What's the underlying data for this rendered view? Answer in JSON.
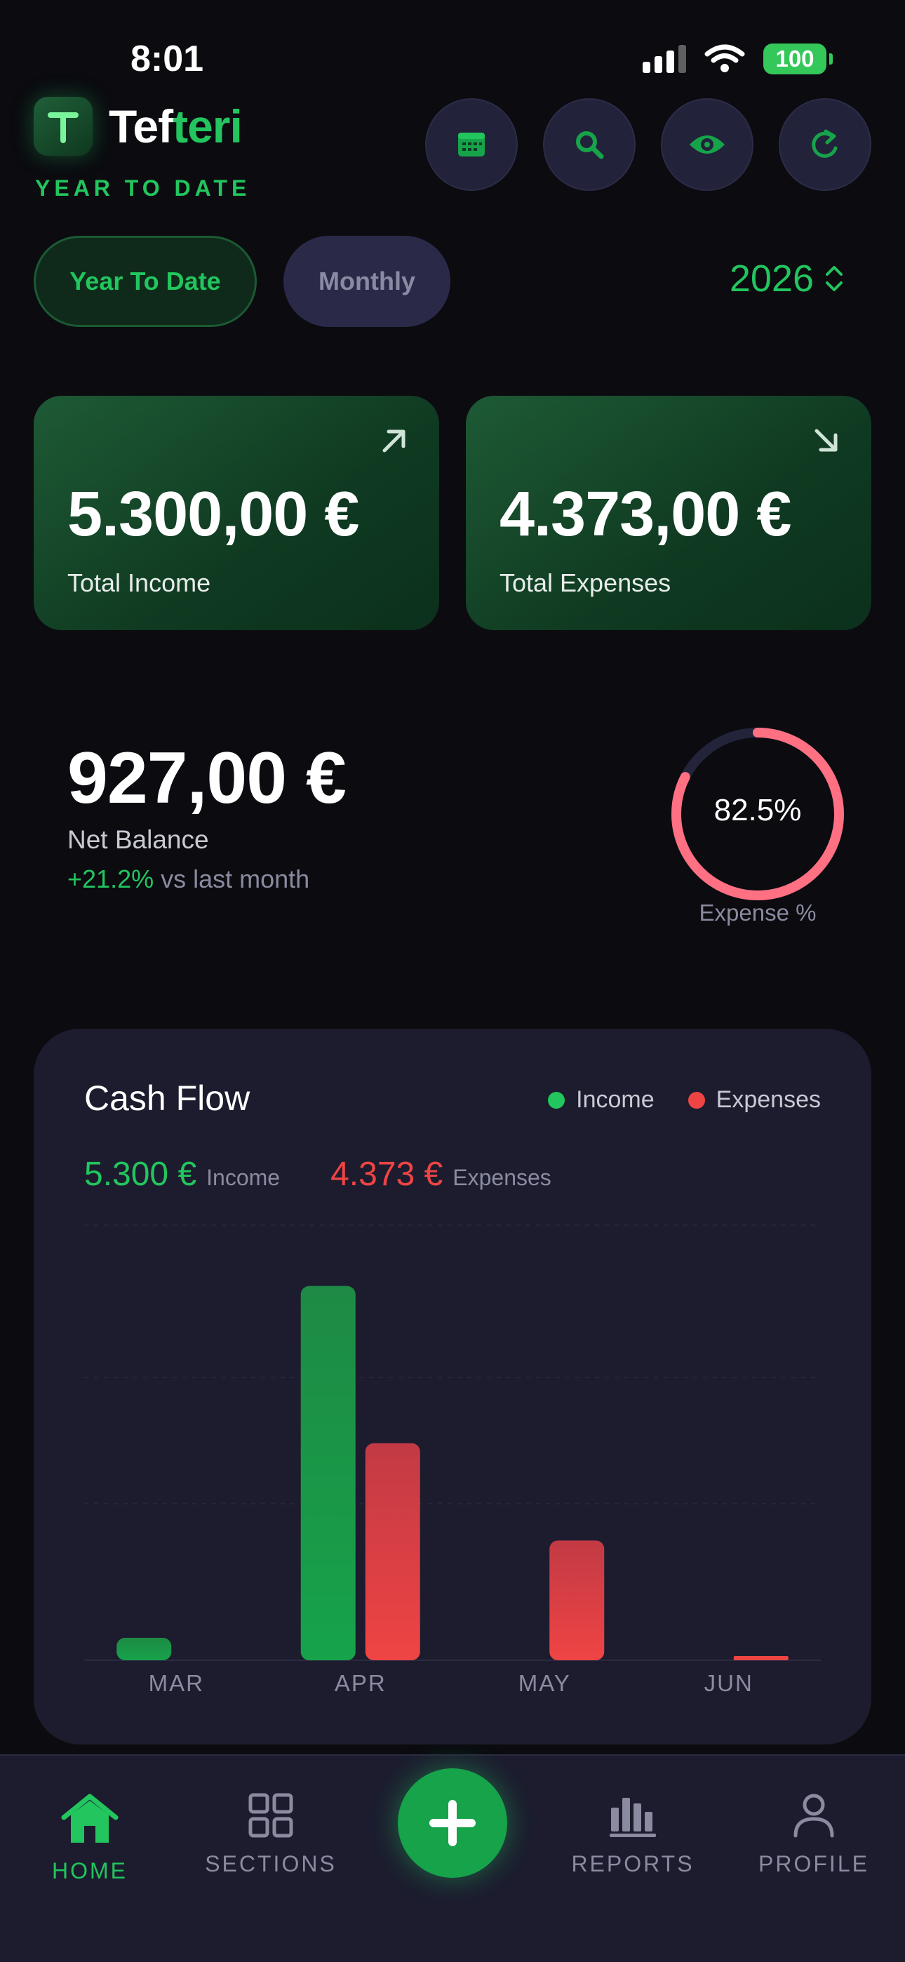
{
  "status_bar": {
    "time": "8:01",
    "battery": "100"
  },
  "header": {
    "logo_letter": "T",
    "app_name_part1": "Tef",
    "app_name_part2": "teri",
    "subtitle": "YEAR TO DATE",
    "buttons": [
      "calendar-icon",
      "search-icon",
      "eye-icon",
      "refresh-icon"
    ]
  },
  "tabs": {
    "active": "Year To Date",
    "inactive": "Monthly"
  },
  "year": "2026",
  "summary": {
    "income": {
      "amount": "5.300,00 €",
      "label": "Total Income"
    },
    "expenses": {
      "amount": "4.373,00 €",
      "label": "Total Expenses"
    }
  },
  "net": {
    "amount": "927,00 €",
    "label": "Net Balance",
    "change": "+21.2%",
    "change_suffix": "vs last month"
  },
  "expense_ratio": {
    "value": 82.5,
    "text": "82.5%",
    "label": "Expense %"
  },
  "cash_flow": {
    "title": "Cash Flow",
    "legend_income": "Income",
    "legend_expenses": "Expenses",
    "income_total": "5.300 €",
    "income_total_label": "Income",
    "expenses_total": "4.373 €",
    "expenses_total_label": "Expenses"
  },
  "chart_data": {
    "type": "bar",
    "categories": [
      "MAR",
      "APR",
      "MAY",
      "JUN"
    ],
    "series": [
      {
        "name": "Income",
        "values": [
          300,
          5000,
          0,
          0
        ]
      },
      {
        "name": "Expenses",
        "values": [
          0,
          2900,
          1600,
          50
        ]
      }
    ],
    "ylim": [
      0,
      6000
    ],
    "colors": {
      "income": "#22c55e",
      "expenses": "#ef4444"
    }
  },
  "nav": {
    "home": "HOME",
    "sections": "SECTIONS",
    "reports": "REPORTS",
    "profile": "PROFILE"
  },
  "colors": {
    "accent": "#22c55e",
    "danger": "#ef4444",
    "ring": "#ff7083"
  }
}
